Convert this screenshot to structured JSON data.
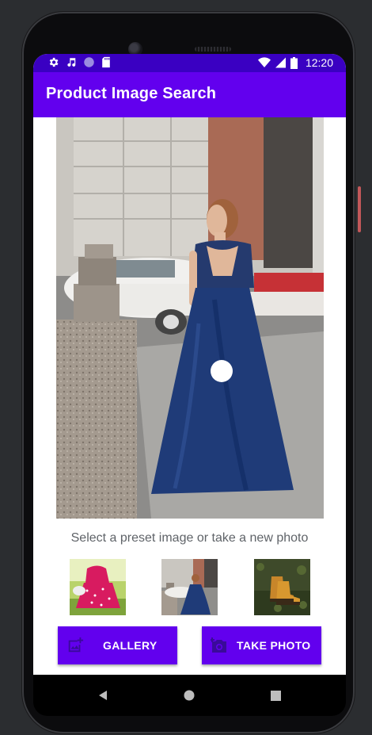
{
  "status_bar": {
    "time": "12:20",
    "left_icons": [
      "gear-icon",
      "music-note-icon",
      "circle-notification-icon",
      "sd-card-icon"
    ],
    "right_icons": [
      "wifi-icon",
      "signal-icon",
      "battery-icon"
    ]
  },
  "app_bar": {
    "title": "Product Image Search"
  },
  "main_image": {
    "description_icon": "tap-target-dot-icon"
  },
  "hint_text": "Select a preset image or take a new photo",
  "presets": [
    {
      "name": "preset-polka-dress"
    },
    {
      "name": "preset-blue-gown"
    },
    {
      "name": "preset-boots"
    }
  ],
  "buttons": {
    "gallery_label": "GALLERY",
    "take_photo_label": "TAKE PHOTO"
  },
  "colors": {
    "primary": "#6200ee",
    "status_bar": "#3a00c2",
    "on_primary": "#ffffff"
  }
}
